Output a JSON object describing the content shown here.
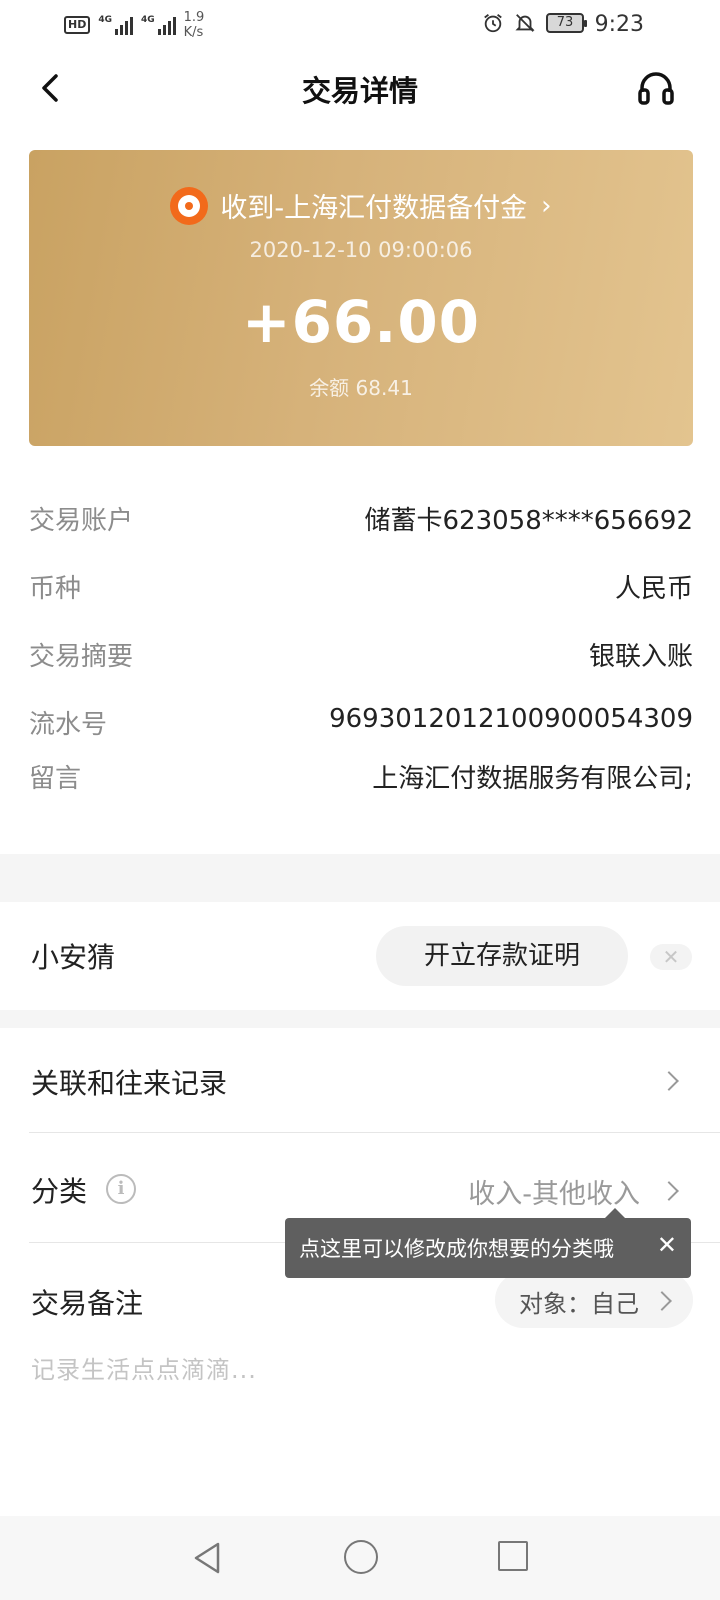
{
  "status_bar": {
    "hd": "HD",
    "sim1_net": "4G",
    "sim2_net": "4G",
    "speed_value": "1.9",
    "speed_unit": "K/s",
    "battery": "73",
    "time": "9:23"
  },
  "nav": {
    "title": "交易详情",
    "back_icon": "chevron-left-icon",
    "support_icon": "headset-icon"
  },
  "card": {
    "merchant": "收到-上海汇付数据备付金",
    "time": "2020-12-10 09:00:06",
    "amount": "+66.00",
    "balance": "余额 68.41",
    "gradient_start": "#c9a262",
    "gradient_end": "#e3c48f",
    "logo_color": "#f26a1b"
  },
  "details": {
    "account_label": "交易账户",
    "account_value": "储蓄卡623058****656692",
    "currency_label": "币种",
    "currency_value": "人民币",
    "summary_label": "交易摘要",
    "summary_value": "银联入账",
    "serial_label": "流水号",
    "serial_value": "969301201210090005430​9",
    "message_label": "留言",
    "message_value": "上海汇付数据服务有限公司;"
  },
  "guess": {
    "label": "小安猜",
    "button": "开立存款证明",
    "close": "✕"
  },
  "related": {
    "label": "关联和往来记录"
  },
  "category": {
    "label": "分类",
    "info": "i",
    "value": "收入-其他收入"
  },
  "tooltip": {
    "text": "点这里可以修改成你想要的分类哦",
    "close": "✕"
  },
  "note": {
    "label": "交易备注",
    "object": "对象：自己",
    "placeholder": "记录生活点点滴滴..."
  }
}
